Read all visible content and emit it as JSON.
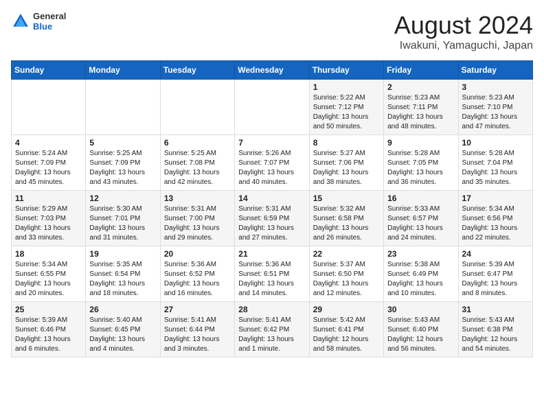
{
  "header": {
    "logo_general": "General",
    "logo_blue": "Blue",
    "month": "August 2024",
    "location": "Iwakuni, Yamaguchi, Japan"
  },
  "weekdays": [
    "Sunday",
    "Monday",
    "Tuesday",
    "Wednesday",
    "Thursday",
    "Friday",
    "Saturday"
  ],
  "weeks": [
    [
      {
        "day": "",
        "info": ""
      },
      {
        "day": "",
        "info": ""
      },
      {
        "day": "",
        "info": ""
      },
      {
        "day": "",
        "info": ""
      },
      {
        "day": "1",
        "info": "Sunrise: 5:22 AM\nSunset: 7:12 PM\nDaylight: 13 hours\nand 50 minutes."
      },
      {
        "day": "2",
        "info": "Sunrise: 5:23 AM\nSunset: 7:11 PM\nDaylight: 13 hours\nand 48 minutes."
      },
      {
        "day": "3",
        "info": "Sunrise: 5:23 AM\nSunset: 7:10 PM\nDaylight: 13 hours\nand 47 minutes."
      }
    ],
    [
      {
        "day": "4",
        "info": "Sunrise: 5:24 AM\nSunset: 7:09 PM\nDaylight: 13 hours\nand 45 minutes."
      },
      {
        "day": "5",
        "info": "Sunrise: 5:25 AM\nSunset: 7:09 PM\nDaylight: 13 hours\nand 43 minutes."
      },
      {
        "day": "6",
        "info": "Sunrise: 5:25 AM\nSunset: 7:08 PM\nDaylight: 13 hours\nand 42 minutes."
      },
      {
        "day": "7",
        "info": "Sunrise: 5:26 AM\nSunset: 7:07 PM\nDaylight: 13 hours\nand 40 minutes."
      },
      {
        "day": "8",
        "info": "Sunrise: 5:27 AM\nSunset: 7:06 PM\nDaylight: 13 hours\nand 38 minutes."
      },
      {
        "day": "9",
        "info": "Sunrise: 5:28 AM\nSunset: 7:05 PM\nDaylight: 13 hours\nand 36 minutes."
      },
      {
        "day": "10",
        "info": "Sunrise: 5:28 AM\nSunset: 7:04 PM\nDaylight: 13 hours\nand 35 minutes."
      }
    ],
    [
      {
        "day": "11",
        "info": "Sunrise: 5:29 AM\nSunset: 7:03 PM\nDaylight: 13 hours\nand 33 minutes."
      },
      {
        "day": "12",
        "info": "Sunrise: 5:30 AM\nSunset: 7:01 PM\nDaylight: 13 hours\nand 31 minutes."
      },
      {
        "day": "13",
        "info": "Sunrise: 5:31 AM\nSunset: 7:00 PM\nDaylight: 13 hours\nand 29 minutes."
      },
      {
        "day": "14",
        "info": "Sunrise: 5:31 AM\nSunset: 6:59 PM\nDaylight: 13 hours\nand 27 minutes."
      },
      {
        "day": "15",
        "info": "Sunrise: 5:32 AM\nSunset: 6:58 PM\nDaylight: 13 hours\nand 26 minutes."
      },
      {
        "day": "16",
        "info": "Sunrise: 5:33 AM\nSunset: 6:57 PM\nDaylight: 13 hours\nand 24 minutes."
      },
      {
        "day": "17",
        "info": "Sunrise: 5:34 AM\nSunset: 6:56 PM\nDaylight: 13 hours\nand 22 minutes."
      }
    ],
    [
      {
        "day": "18",
        "info": "Sunrise: 5:34 AM\nSunset: 6:55 PM\nDaylight: 13 hours\nand 20 minutes."
      },
      {
        "day": "19",
        "info": "Sunrise: 5:35 AM\nSunset: 6:54 PM\nDaylight: 13 hours\nand 18 minutes."
      },
      {
        "day": "20",
        "info": "Sunrise: 5:36 AM\nSunset: 6:52 PM\nDaylight: 13 hours\nand 16 minutes."
      },
      {
        "day": "21",
        "info": "Sunrise: 5:36 AM\nSunset: 6:51 PM\nDaylight: 13 hours\nand 14 minutes."
      },
      {
        "day": "22",
        "info": "Sunrise: 5:37 AM\nSunset: 6:50 PM\nDaylight: 13 hours\nand 12 minutes."
      },
      {
        "day": "23",
        "info": "Sunrise: 5:38 AM\nSunset: 6:49 PM\nDaylight: 13 hours\nand 10 minutes."
      },
      {
        "day": "24",
        "info": "Sunrise: 5:39 AM\nSunset: 6:47 PM\nDaylight: 13 hours\nand 8 minutes."
      }
    ],
    [
      {
        "day": "25",
        "info": "Sunrise: 5:39 AM\nSunset: 6:46 PM\nDaylight: 13 hours\nand 6 minutes."
      },
      {
        "day": "26",
        "info": "Sunrise: 5:40 AM\nSunset: 6:45 PM\nDaylight: 13 hours\nand 4 minutes."
      },
      {
        "day": "27",
        "info": "Sunrise: 5:41 AM\nSunset: 6:44 PM\nDaylight: 13 hours\nand 3 minutes."
      },
      {
        "day": "28",
        "info": "Sunrise: 5:41 AM\nSunset: 6:42 PM\nDaylight: 13 hours\nand 1 minute."
      },
      {
        "day": "29",
        "info": "Sunrise: 5:42 AM\nSunset: 6:41 PM\nDaylight: 12 hours\nand 58 minutes."
      },
      {
        "day": "30",
        "info": "Sunrise: 5:43 AM\nSunset: 6:40 PM\nDaylight: 12 hours\nand 56 minutes."
      },
      {
        "day": "31",
        "info": "Sunrise: 5:43 AM\nSunset: 6:38 PM\nDaylight: 12 hours\nand 54 minutes."
      }
    ]
  ]
}
